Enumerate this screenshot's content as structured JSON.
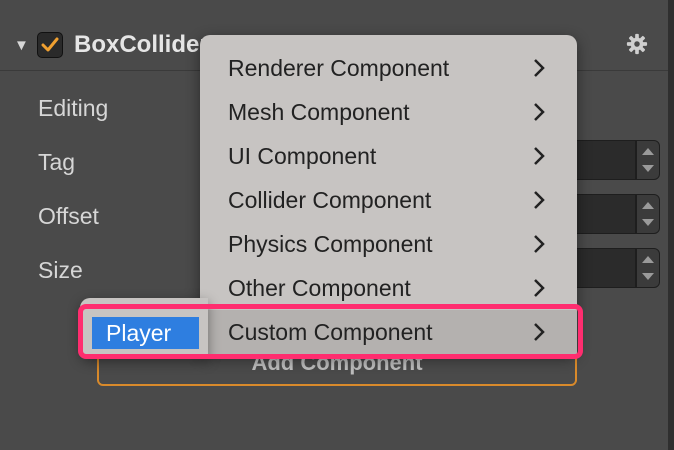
{
  "component": {
    "name": "BoxCollider",
    "enabled": true
  },
  "properties": [
    {
      "label": "Editing"
    },
    {
      "label": "Tag"
    },
    {
      "label": "Offset"
    },
    {
      "label": "Size"
    }
  ],
  "add_button": {
    "label": "Add Component"
  },
  "menu": {
    "items": [
      {
        "label": "Renderer Component"
      },
      {
        "label": "Mesh Component"
      },
      {
        "label": "UI Component"
      },
      {
        "label": "Collider Component"
      },
      {
        "label": "Physics Component"
      },
      {
        "label": "Other Component"
      },
      {
        "label": "Custom Component"
      }
    ],
    "active_item": "Custom Component"
  },
  "submenu": {
    "items": [
      {
        "label": "Player"
      }
    ]
  },
  "colors": {
    "accent_orange": "#d98a2b",
    "highlight_pink": "#ff2d6f",
    "selection_blue": "#2e7ee0"
  }
}
